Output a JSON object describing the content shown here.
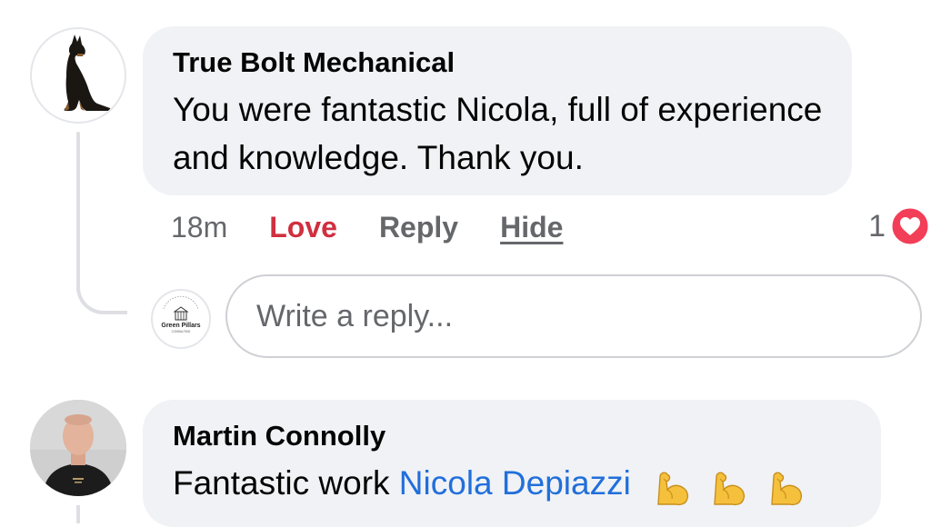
{
  "comment1": {
    "author": "True Bolt Mechanical",
    "text": "You were fantastic Nicola, full of experience and knowledge. Thank you.",
    "actions": {
      "time": "18m",
      "love": "Love",
      "reply": "Reply",
      "hide": "Hide"
    },
    "reaction_count": "1",
    "reaction_icon": "heart-reaction-icon",
    "avatar_icon": "dog-silhouette-icon"
  },
  "reply_input": {
    "placeholder": "Write a reply...",
    "avatar_label": "Green Pillars",
    "avatar_sublabel": "CONSULTING"
  },
  "comment2": {
    "author": "Martin Connolly",
    "text_prefix": "Fantastic work ",
    "mention": "Nicola Depiazzi",
    "emojis": [
      "flexed-biceps-icon",
      "flexed-biceps-icon",
      "flexed-biceps-icon"
    ]
  },
  "colors": {
    "bubble": "#f0f2f5",
    "love": "#d02f3f",
    "mention": "#216fdb",
    "muted": "#65676b"
  }
}
